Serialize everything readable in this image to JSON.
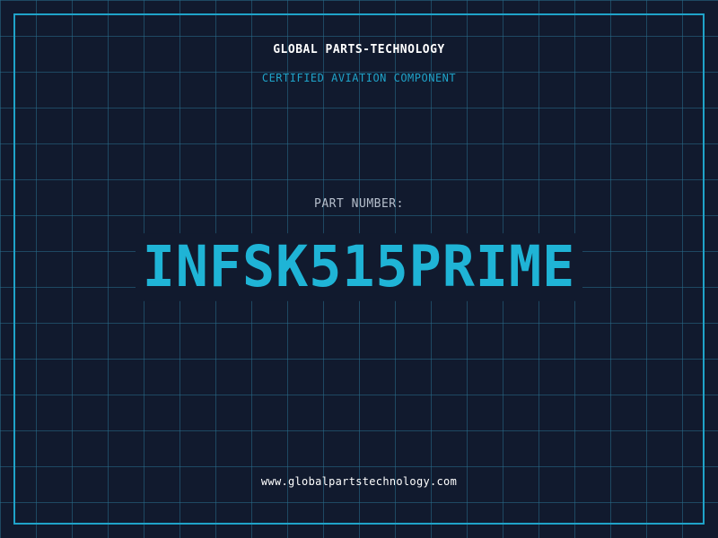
{
  "header": {
    "company": "GLOBAL PARTS-TECHNOLOGY",
    "subtitle": "CERTIFIED AVIATION COMPONENT"
  },
  "main": {
    "part_label": "PART NUMBER:",
    "part_number": "INFSK515PRIME"
  },
  "footer": {
    "url": "www.globalpartstechnology.com"
  },
  "colors": {
    "background": "#111a2e",
    "grid": "#286e8c",
    "accent": "#1fa3c9",
    "part_number": "#1fb4d6",
    "text": "#ffffff",
    "label": "#b6bfcc"
  }
}
